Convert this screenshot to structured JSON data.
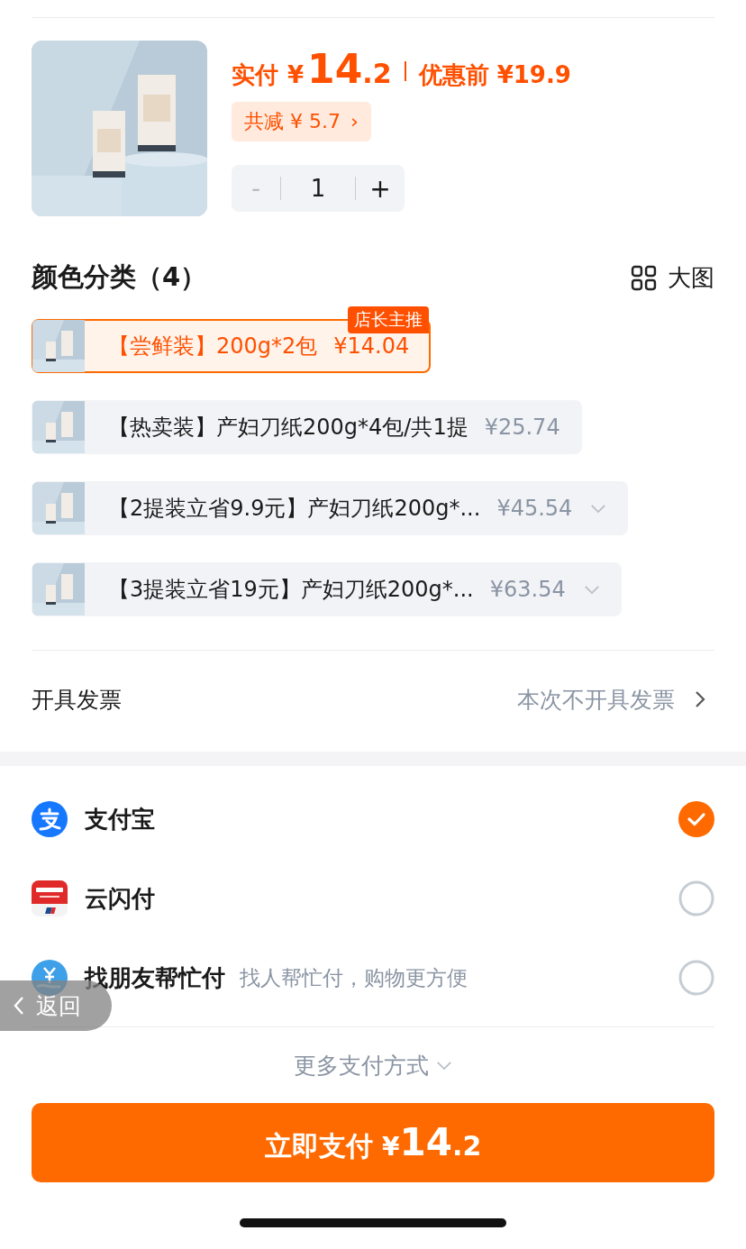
{
  "price": {
    "label": "实付",
    "currency": "¥",
    "integer": "14",
    "decimal": ".2",
    "original": "优惠前 ¥19.9"
  },
  "discount": {
    "label": "共减 ¥ 5.7",
    "arrow": "›"
  },
  "quantity": {
    "minus": "-",
    "value": "1",
    "plus": "+",
    "minus_disabled": true
  },
  "category": {
    "title": "颜色分类（4）",
    "view_label": "大图"
  },
  "options": [
    {
      "name": "【尝鲜装】200g*2包",
      "price": "¥14.04",
      "selected": true,
      "badge": "店长主推",
      "dropdown": false
    },
    {
      "name": "【热卖装】产妇刀纸200g*4包/共1提",
      "price": "¥25.74",
      "selected": false,
      "dropdown": false
    },
    {
      "name": "【2提装立省9.9元】产妇刀纸200g*...",
      "price": "¥45.54",
      "selected": false,
      "dropdown": true
    },
    {
      "name": "【3提装立省19元】产妇刀纸200g*...",
      "price": "¥63.54",
      "selected": false,
      "dropdown": true
    }
  ],
  "invoice": {
    "label": "开具发票",
    "value": "本次不开具发票"
  },
  "payments": [
    {
      "kind": "alipay",
      "name": "支付宝",
      "selected": true
    },
    {
      "kind": "unionpay",
      "name": "云闪付",
      "selected": false
    },
    {
      "kind": "friend",
      "name": "找朋友帮忙付",
      "hint": "找人帮忙付，购物更方便",
      "selected": false
    }
  ],
  "back_button": {
    "label": "返回"
  },
  "more_payments": "更多支付方式",
  "pay_button": {
    "label": "立即支付",
    "currency": "¥",
    "integer": "14",
    "decimal": ".2"
  }
}
